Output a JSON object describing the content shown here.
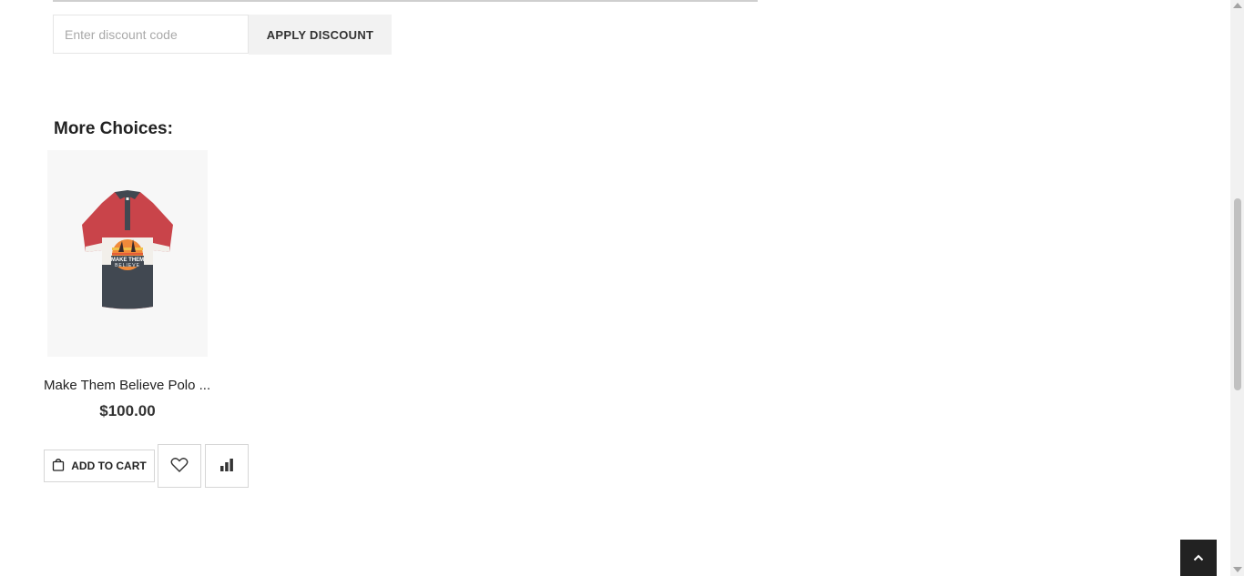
{
  "discount": {
    "placeholder": "Enter discount code",
    "value": "",
    "apply_label": "APPLY DISCOUNT"
  },
  "more_choices": {
    "title": "More Choices:",
    "products": [
      {
        "name": "Make Them Believe Polo ...",
        "price": "$100.00",
        "image_print_text": "MAKE THEM BELIEVE",
        "add_to_cart_label": "ADD TO CART",
        "icons": {
          "cart": "shopping-bag-icon",
          "wishlist": "heart-icon",
          "compare": "bar-chart-icon"
        }
      }
    ]
  },
  "colors": {
    "polo_red": "#c9444a",
    "polo_dark": "#414851",
    "back_to_top_bg": "#222222"
  },
  "back_to_top": {
    "icon": "chevron-up-icon"
  }
}
